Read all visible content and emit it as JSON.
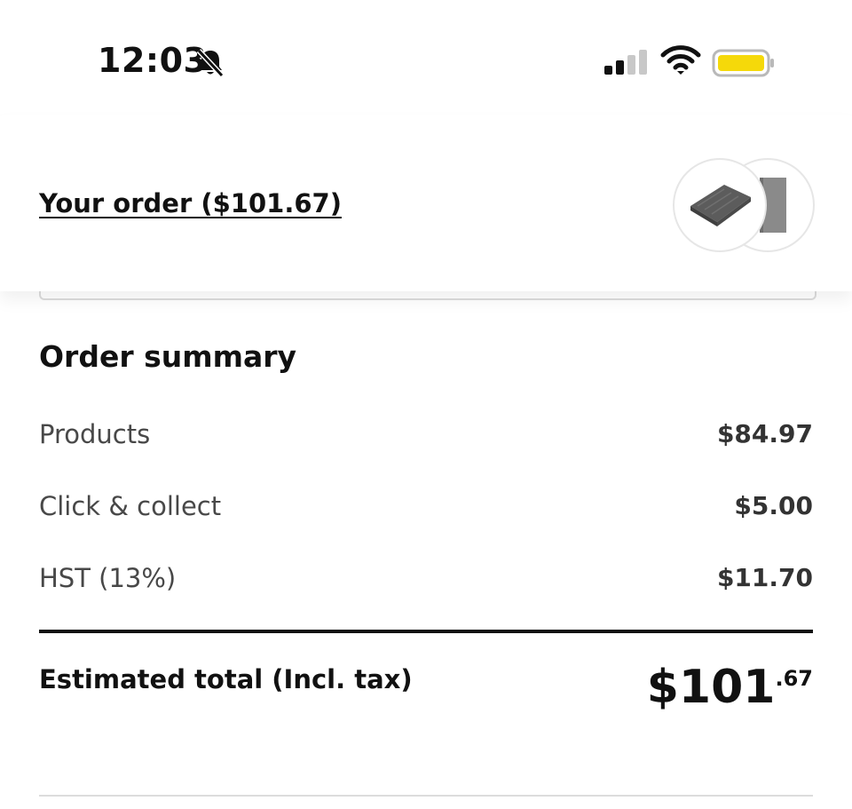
{
  "status_bar": {
    "time": "12:03",
    "bell_icon": "bell-slash-icon",
    "signal_icon": "cellular-signal-icon",
    "wifi_icon": "wifi-icon",
    "battery_icon": "battery-icon",
    "battery_color": "#f5d90a"
  },
  "order_header": {
    "your_order_label": "Your order ($101.67)",
    "thumbnails": [
      "product-thumbnail-blanket",
      "product-thumbnail-rug"
    ]
  },
  "summary": {
    "title": "Order summary",
    "rows": [
      {
        "label": "Products",
        "value": "$84.97"
      },
      {
        "label": "Click & collect",
        "value": "$5.00"
      },
      {
        "label": "HST (13%)",
        "value": "$11.70"
      }
    ],
    "total": {
      "label": "Estimated total (Incl. tax)",
      "value_main": "$101",
      "value_cents": ".67"
    }
  }
}
